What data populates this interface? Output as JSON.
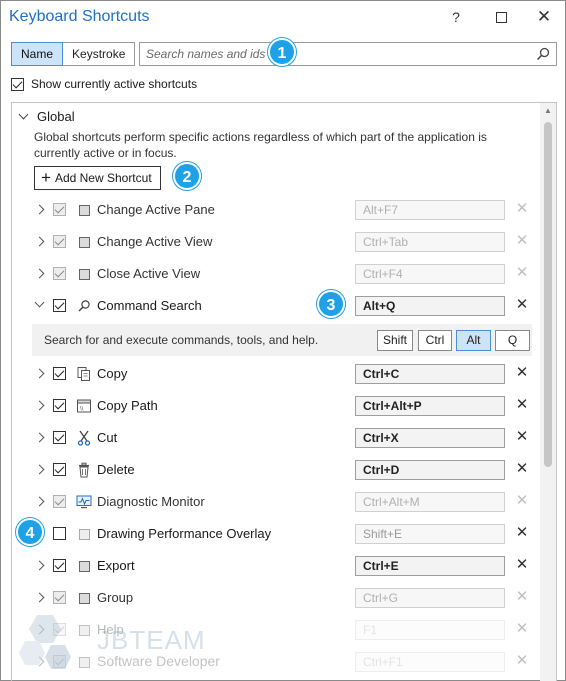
{
  "window": {
    "title": "Keyboard Shortcuts",
    "help_glyph": "?",
    "close_glyph": "✕"
  },
  "search": {
    "tab_name": "Name",
    "tab_keystroke": "Keystroke",
    "placeholder": "Search names and ids",
    "show_active_label": "Show currently active shortcuts",
    "show_active_checked": true
  },
  "group": {
    "title": "Global",
    "description": "Global shortcuts perform specific actions regardless of which part of the application is currently active or in focus.",
    "add_button": "Add New Shortcut"
  },
  "shortcuts": [
    {
      "name": "Change Active Pane",
      "key": "Alt+F7",
      "icon": "command-icon",
      "checked": true,
      "enabled": false
    },
    {
      "name": "Change Active View",
      "key": "Ctrl+Tab",
      "icon": "command-icon",
      "checked": true,
      "enabled": false
    },
    {
      "name": "Close Active View",
      "key": "Ctrl+F4",
      "icon": "command-icon",
      "checked": true,
      "enabled": false
    },
    {
      "name": "Command Search",
      "key": "Alt+Q",
      "icon": "search-icon",
      "checked": true,
      "enabled": true,
      "expanded": true
    },
    {
      "name": "Copy",
      "key": "Ctrl+C",
      "icon": "copy-icon",
      "checked": true,
      "enabled": true
    },
    {
      "name": "Copy Path",
      "key": "Ctrl+Alt+P",
      "icon": "copy-path-icon",
      "checked": true,
      "enabled": true
    },
    {
      "name": "Cut",
      "key": "Ctrl+X",
      "icon": "scissors-icon",
      "checked": true,
      "enabled": true
    },
    {
      "name": "Delete",
      "key": "Ctrl+D",
      "icon": "trash-icon",
      "checked": true,
      "enabled": true
    },
    {
      "name": "Diagnostic Monitor",
      "key": "Ctrl+Alt+M",
      "icon": "monitor-icon",
      "checked": true,
      "enabled": false
    },
    {
      "name": "Drawing Performance Overlay",
      "key": "Shift+E",
      "icon": "command-icon",
      "checked": false,
      "enabled": true
    },
    {
      "name": "Export",
      "key": "Ctrl+E",
      "icon": "command-icon",
      "checked": true,
      "enabled": true
    },
    {
      "name": "Group",
      "key": "Ctrl+G",
      "icon": "command-icon",
      "checked": true,
      "enabled": false
    },
    {
      "name": "Help",
      "key": "F1",
      "icon": "command-icon",
      "checked": true,
      "enabled": false
    },
    {
      "name": "",
      "key": "Ctrl+F1",
      "icon": "command-icon",
      "checked": true,
      "enabled": false
    }
  ],
  "command_search_detail": {
    "description": "Search for and execute commands, tools, and help.",
    "modifiers": [
      "Shift",
      "Ctrl",
      "Alt",
      "Q"
    ],
    "active_modifier": "Alt"
  },
  "callouts": [
    "1",
    "2",
    "3",
    "4"
  ],
  "watermark": {
    "text": "JBTEAM",
    "subtext": "Software Developer"
  },
  "colors": {
    "title": "#1f6fc5",
    "accent": "#cde3f7",
    "callout": "#1ea1e6"
  }
}
